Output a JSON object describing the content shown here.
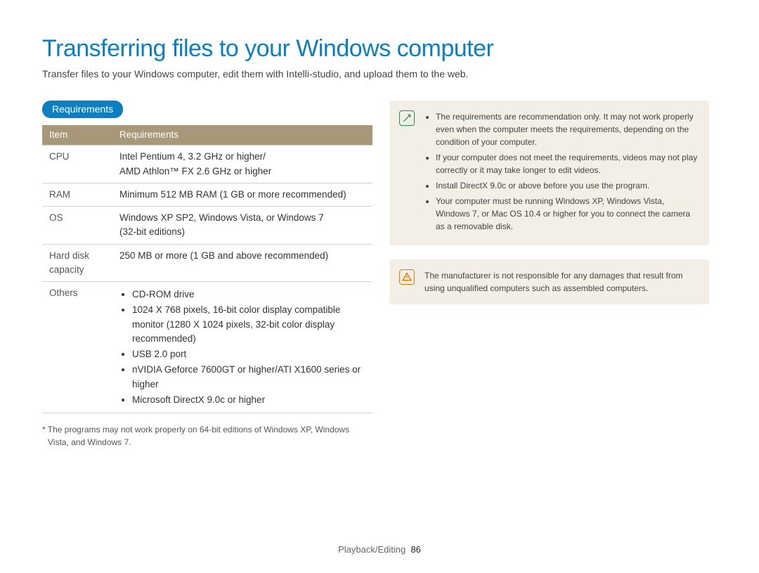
{
  "title": "Transferring files to your Windows computer",
  "subtitle": "Transfer files to your Windows computer, edit them with Intelli-studio, and upload them to the web.",
  "section_label": "Requirements",
  "table": {
    "head_item": "Item",
    "head_req": "Requirements",
    "rows": {
      "cpu": {
        "label": "CPU",
        "value": "Intel Pentium 4, 3.2 GHz or higher/\nAMD Athlon™ FX 2.6 GHz or higher"
      },
      "ram": {
        "label": "RAM",
        "value": "Minimum 512 MB RAM (1 GB or more recommended)"
      },
      "os": {
        "label": "OS",
        "value": "Windows XP SP2, Windows Vista, or Windows 7\n(32-bit editions)"
      },
      "hdd": {
        "label": "Hard disk capacity",
        "value": "250 MB or more (1 GB and above recommended)"
      },
      "others_label": "Others",
      "others": [
        "CD-ROM drive",
        "1024 X 768 pixels, 16-bit color display compatible monitor (1280 X 1024 pixels, 32-bit color display recommended)",
        "USB 2.0 port",
        "nVIDIA Geforce 7600GT or higher/ATI X1600 series or higher",
        "Microsoft DirectX 9.0c or higher"
      ]
    }
  },
  "footnote": "* The programs may not work properly on 64-bit editions of Windows XP, Windows Vista, and Windows 7.",
  "notes": {
    "info": [
      "The requirements are recommendation only. It may not work properly even when the computer meets the requirements, depending on the condition of your computer.",
      "If your computer does not meet the requirements, videos may not play correctly or it may take longer to edit videos.",
      "Install DirectX 9.0c or above before you use the program.",
      "Your computer must be running Windows XP, Windows Vista, Windows 7, or Mac OS 10.4 or higher for you to connect the camera as a removable disk."
    ],
    "warn": "The manufacturer is not responsible for any damages that result from using unqualified computers such as assembled computers."
  },
  "footer": {
    "section": "Playback/Editing",
    "page": "86"
  }
}
